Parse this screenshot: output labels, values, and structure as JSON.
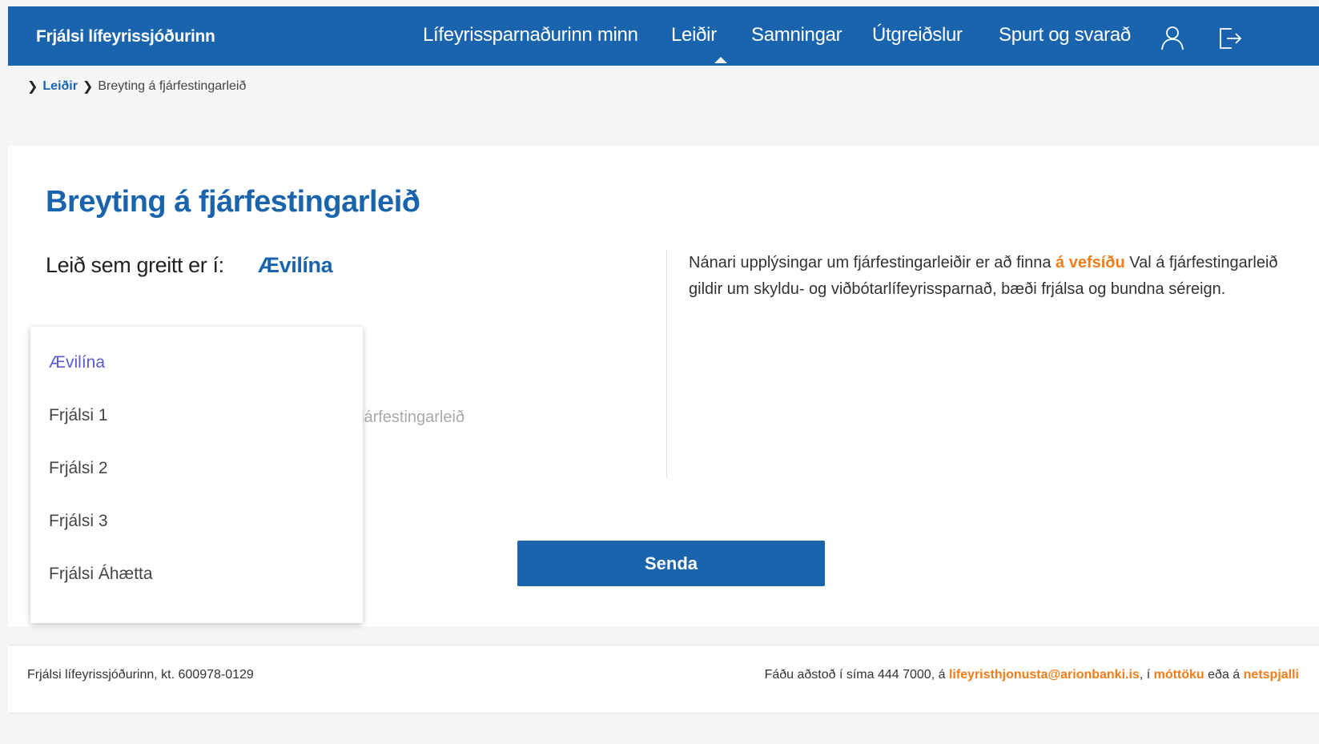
{
  "header": {
    "brand": "Frjálsi lífeyrissjóðurinn",
    "nav": [
      "Lífeyrissparnaðurinn minn",
      "Leiðir",
      "Samningar",
      "Útgreiðslur",
      "Spurt og svarað"
    ],
    "active_nav": "Leiðir",
    "icons": [
      "user-icon",
      "logout-icon"
    ]
  },
  "breadcrumb": {
    "link": "Leiðir",
    "current": "Breyting á fjárfestingarleið"
  },
  "main": {
    "title": "Breyting á fjárfestingarleið",
    "route_label": "Leið sem greitt er í:",
    "route_value": "Ævilína",
    "partial_text": "járfestingarleið",
    "send_label": "Senda"
  },
  "info": {
    "text1": "Nánari upplýsingar um fjárfestingarleiðir er að finna ",
    "link": "á vefsíðu",
    "text2": " Val á fjárfestingarleið gildir um skyldu- og viðbótarlífeyrissparnað, bæði frjálsa og bundna séreign."
  },
  "dropdown": {
    "options": [
      "Ævilína",
      "Frjálsi 1",
      "Frjálsi 2",
      "Frjálsi 3",
      "Frjálsi Áhætta"
    ],
    "selected": "Ævilína"
  },
  "footer": {
    "left": "Frjálsi lífeyrissjóðurinn, kt. 600978-0129",
    "help_prefix": "Fáðu aðstoð í síma 444 7000, á ",
    "email_link": "lifeyristhjonusta@arionbanki.is",
    "sep1": ", í ",
    "reception_link": "móttöku",
    "sep2": " eða á ",
    "chat_link": "netspjalli"
  },
  "colors": {
    "brand_blue": "#1a64ad",
    "accent_orange": "#f07d1a",
    "selected_option": "#5b5ad1"
  }
}
